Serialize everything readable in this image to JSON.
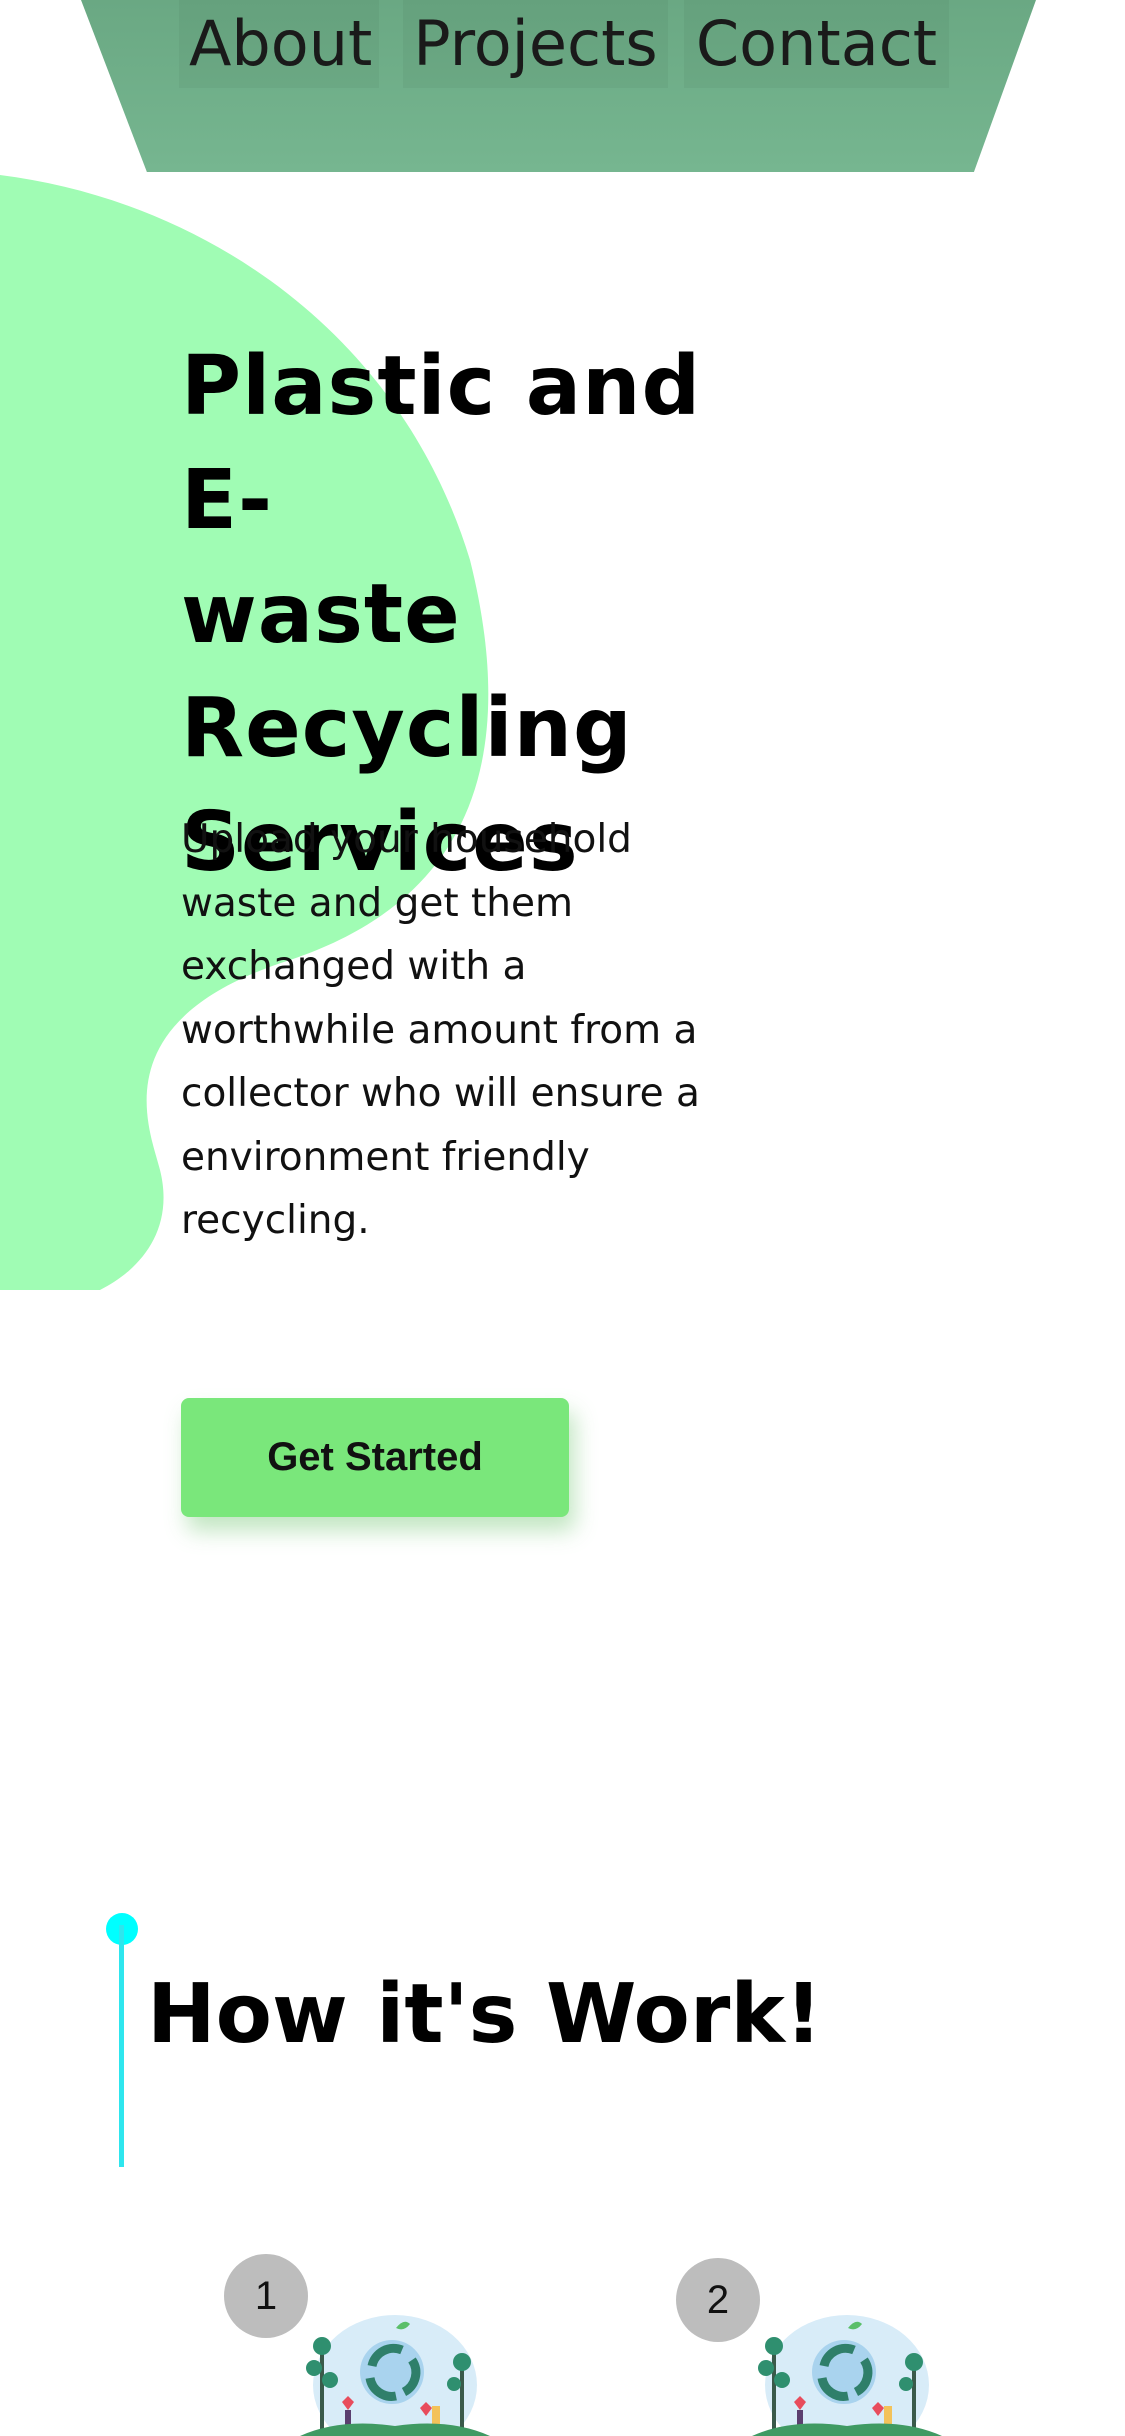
{
  "nav": {
    "items": [
      {
        "label": "About"
      },
      {
        "label": "Projects"
      },
      {
        "label": "Contact"
      }
    ]
  },
  "hero": {
    "title_lines": [
      "Plastic and E-",
      "waste",
      "Recycling",
      "Services"
    ],
    "description_lines": [
      "Upload your household",
      "waste and get them",
      "exchanged with a",
      "worthwhile amount from a",
      "collector who will ensure a",
      "environment friendly",
      "recycling."
    ],
    "cta_label": "Get Started"
  },
  "how_it_works": {
    "title": "How it's Work!",
    "steps": [
      {
        "number": "1",
        "illustration": "recycling-illustration"
      },
      {
        "number": "2",
        "illustration": "recycling-illustration"
      }
    ]
  },
  "colors": {
    "nav_bg": "#6aa883",
    "blob": "#a0fcb4",
    "cta_bg": "#7ae77b",
    "accent_timeline": "#00ffff",
    "step_badge": "#bdbdbd"
  }
}
